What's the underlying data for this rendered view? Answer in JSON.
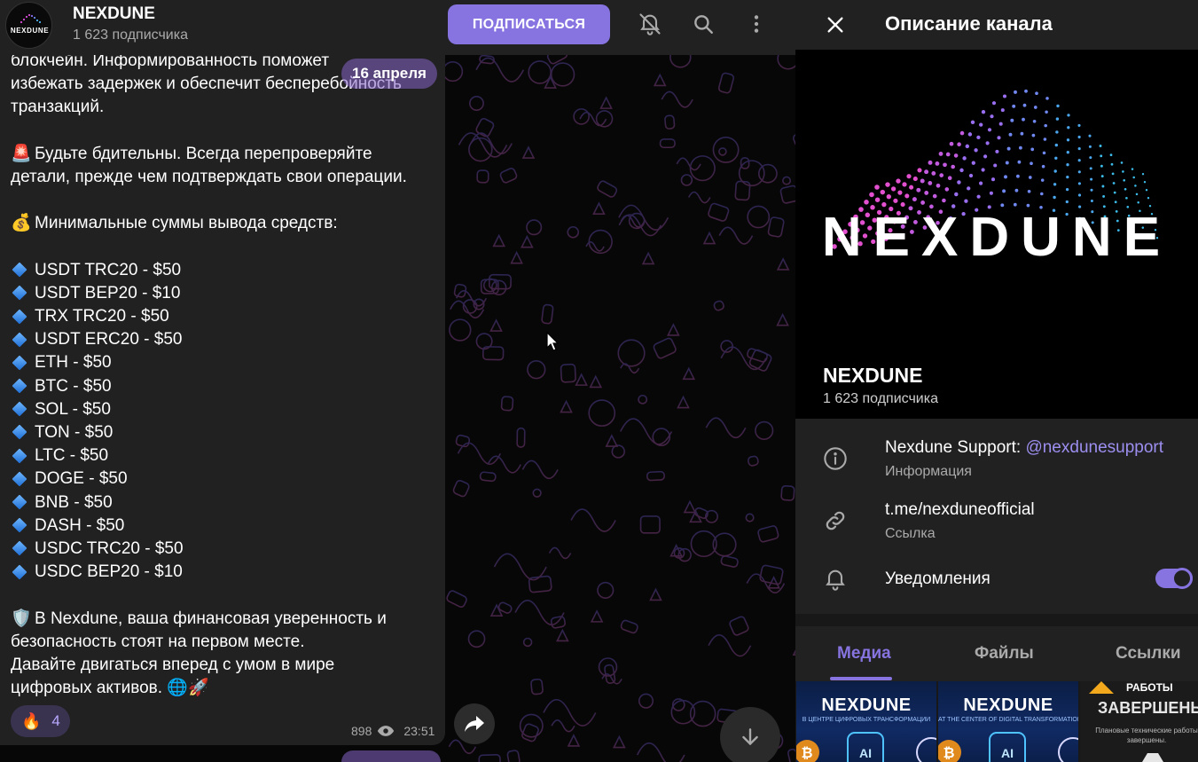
{
  "header": {
    "channel_name": "NEXDUNE",
    "subscribers": "1 623 подписчика",
    "subscribe_label": "ПОДПИСАТЬСЯ"
  },
  "message": {
    "date_pill": "16 апреля",
    "lines": [
      {
        "kind": "text",
        "text": "блокчейн. Информированность поможет"
      },
      {
        "kind": "text",
        "text": "избежать задержек и обеспечит бесперебойность"
      },
      {
        "kind": "text",
        "text": "транзакций."
      },
      {
        "kind": "gap"
      },
      {
        "kind": "emoji",
        "emoji": "🚨",
        "text": "Будьте бдительны. Всегда перепроверяйте"
      },
      {
        "kind": "text",
        "text": "детали, прежде чем подтверждать свои операции."
      },
      {
        "kind": "gap"
      },
      {
        "kind": "emoji",
        "emoji": "💰",
        "text": "Минимальные суммы вывода средств:"
      },
      {
        "kind": "gap"
      },
      {
        "kind": "bullet",
        "text": "USDT TRC20 - $50"
      },
      {
        "kind": "bullet",
        "text": "USDT BEP20 - $10"
      },
      {
        "kind": "bullet",
        "text": "TRX TRC20 - $50"
      },
      {
        "kind": "bullet",
        "text": "USDT ERC20 - $50"
      },
      {
        "kind": "bullet",
        "text": "ETH - $50"
      },
      {
        "kind": "bullet",
        "text": "BTC - $50"
      },
      {
        "kind": "bullet",
        "text": "SOL - $50"
      },
      {
        "kind": "bullet",
        "text": "TON - $50"
      },
      {
        "kind": "bullet",
        "text": "LTC - $50"
      },
      {
        "kind": "bullet",
        "text": "DOGE - $50"
      },
      {
        "kind": "bullet",
        "text": "BNB - $50"
      },
      {
        "kind": "bullet",
        "text": "DASH - $50"
      },
      {
        "kind": "bullet",
        "text": "USDC TRC20 - $50"
      },
      {
        "kind": "bullet",
        "text": "USDC BEP20 - $10"
      },
      {
        "kind": "gap"
      },
      {
        "kind": "emoji",
        "emoji": "🛡️",
        "text": "В Nexdune, ваша финансовая уверенность и"
      },
      {
        "kind": "text",
        "text": "безопасность стоят на первом месте."
      },
      {
        "kind": "text",
        "text": "Давайте двигаться вперед с умом в мире"
      },
      {
        "kind": "text",
        "text": "цифровых активов. 🌐🚀"
      }
    ],
    "reaction_emoji": "🔥",
    "reaction_count": "4",
    "views": "898",
    "time": "23:51"
  },
  "info": {
    "title": "Описание канала",
    "banner_logo_text": "NEXDUNE",
    "name": "NEXDUNE",
    "subscribers": "1 623 подписчика",
    "support_label": "Nexdune Support: ",
    "support_handle": "@nexdunesupport",
    "support_sub": "Информация",
    "link": "t.me/nexduneofficial",
    "link_sub": "Ссылка",
    "notifications_label": "Уведомления",
    "notifications_on": true
  },
  "media_tabs": [
    "Медиа",
    "Файлы",
    "Ссылки"
  ],
  "media_thumbs": [
    {
      "title": "NEXDUNE",
      "subtitle": "В ЦЕНТРЕ ЦИФРОВЫХ ТРАНСФОРМАЦИЙ"
    },
    {
      "title": "NEXDUNE",
      "subtitle": "AT THE CENTER OF DIGITAL TRANSFORMATION"
    },
    {
      "top": "РАБОТЫ",
      "title": "ЗАВЕРШЕНЫ",
      "subtitle": "Плановые технические работы завершены."
    }
  ],
  "colors": {
    "accent": "#8774e1",
    "panel": "#212121",
    "link": "#9c8ff0"
  }
}
